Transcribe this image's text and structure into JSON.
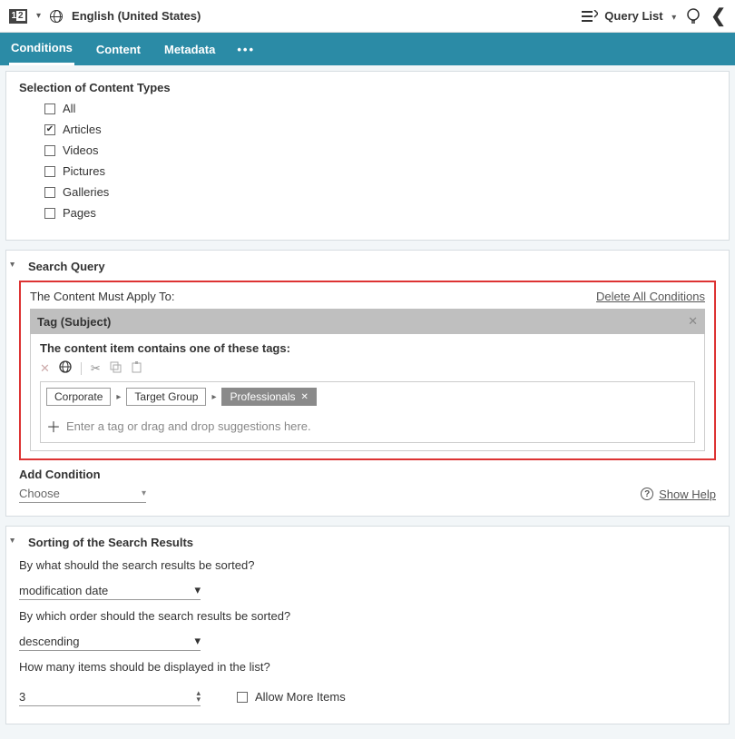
{
  "topbar": {
    "language": "English (United States)",
    "queryListLabel": "Query List"
  },
  "tabs": {
    "conditions": "Conditions",
    "content": "Content",
    "metadata": "Metadata"
  },
  "contentTypes": {
    "title": "Selection of Content Types",
    "items": [
      {
        "label": "All",
        "checked": false
      },
      {
        "label": "Articles",
        "checked": true
      },
      {
        "label": "Videos",
        "checked": false
      },
      {
        "label": "Pictures",
        "checked": false
      },
      {
        "label": "Galleries",
        "checked": false
      },
      {
        "label": "Pages",
        "checked": false
      }
    ]
  },
  "searchQuery": {
    "title": "Search Query",
    "applyTo": "The Content Must Apply To:",
    "deleteAll": "Delete All Conditions",
    "tagHeader": "Tag (Subject)",
    "tagInstr": "The content item contains one of these tags:",
    "breadcrumb": [
      "Corporate",
      "Target Group",
      "Professionals"
    ],
    "addTagPlaceholder": "Enter a tag or drag and drop suggestions here.",
    "addCondition": "Add Condition",
    "choose": "Choose",
    "showHelp": "Show Help"
  },
  "sorting": {
    "title": "Sorting of the Search Results",
    "sortByQ": "By what should the search results be sorted?",
    "sortByValue": "modification date",
    "orderQ": "By which order should the search results be sorted?",
    "orderValue": "descending",
    "countQ": "How many items should be displayed in the list?",
    "countValue": "3",
    "allowMore": "Allow More Items"
  }
}
